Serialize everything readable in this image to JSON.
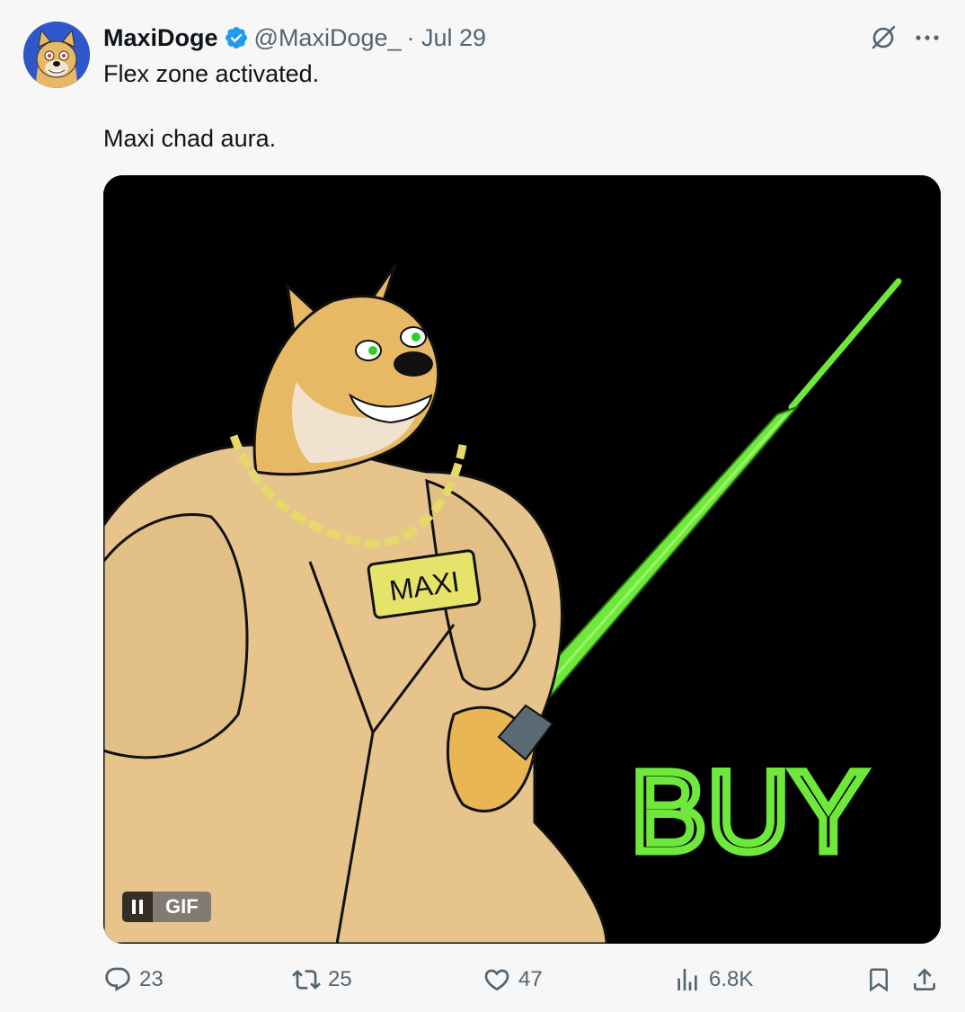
{
  "author": {
    "name": "MaxiDoge",
    "handle": "@MaxiDoge_",
    "date": "· Jul 29",
    "verified": true
  },
  "tweet": {
    "lines": [
      "Flex zone activated.",
      "Maxi chad aura."
    ]
  },
  "media": {
    "type": "gif",
    "badge_label": "GIF",
    "chain_tag_text": "MAXI",
    "overlay_text": "BUY"
  },
  "stats": {
    "replies": "23",
    "reposts": "25",
    "likes": "47",
    "views": "6.8K"
  },
  "colors": {
    "verified": "#1d9bf0",
    "muted_text": "#536471",
    "background": "#f7f7f7",
    "saber_green": "#6ee83a"
  },
  "icons": [
    "grok-icon",
    "more-icon",
    "reply-icon",
    "repost-icon",
    "like-icon",
    "views-icon",
    "bookmark-icon",
    "share-icon",
    "pause-icon"
  ]
}
